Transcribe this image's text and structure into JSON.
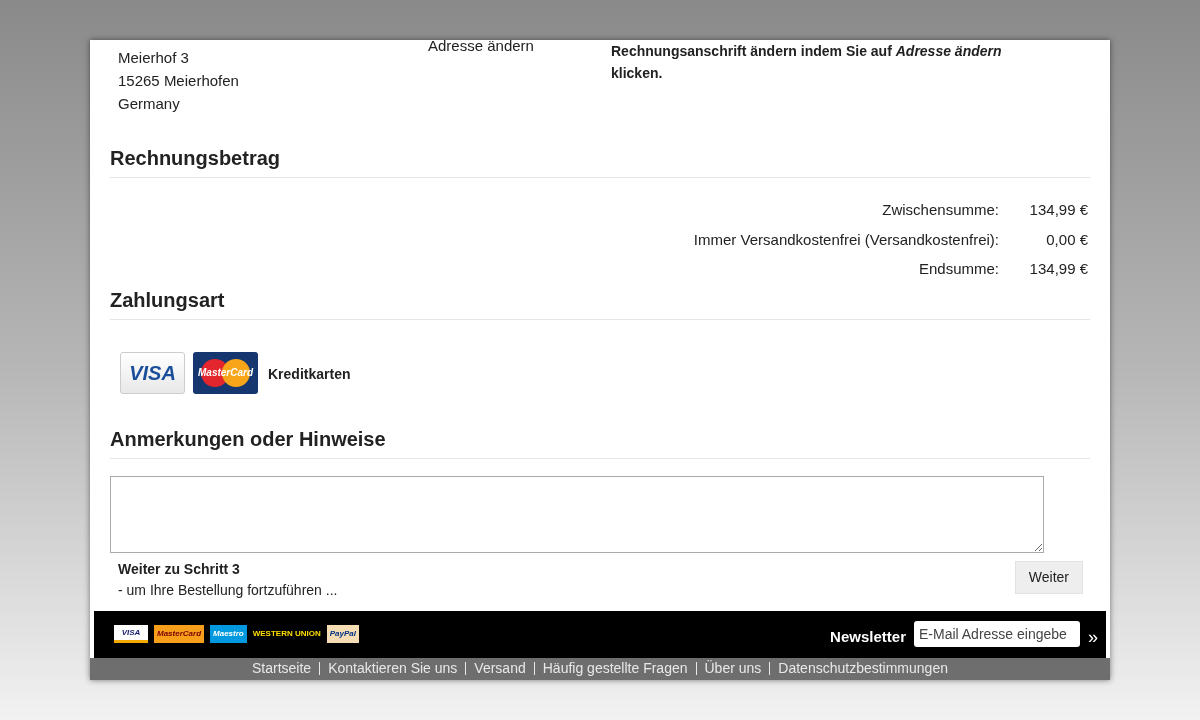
{
  "address": {
    "lines": [
      "Meierhof 3",
      "15265 Meierhofen",
      "Germany"
    ],
    "change_link": "Adresse ändern",
    "note": "Rechnungsanschrift ändern indem Sie auf *Adresse ändern* klicken."
  },
  "invoice": {
    "heading": "Rechnungsbetrag",
    "rows": [
      {
        "label": "Zwischensumme:",
        "value": "134,99 €"
      },
      {
        "label": "Immer Versandkostenfrei (Versandkostenfrei):",
        "value": "0,00 €"
      },
      {
        "label": "Endsumme:",
        "value": "134,99 €"
      }
    ]
  },
  "payment": {
    "heading": "Zahlungsart",
    "visa_logo": "VISA",
    "mastercard_logo": "MasterCard",
    "method": "Kreditkarten"
  },
  "notes": {
    "heading": "Anmerkungen oder Hinweise"
  },
  "next_step": {
    "title": "Weiter zu Schritt 3",
    "subtitle": "- um Ihre Bestellung fortzuführen ...",
    "button": "Weiter"
  },
  "footer": {
    "payment_logos": [
      {
        "kind": "visa",
        "label": "VISA"
      },
      {
        "kind": "mastercard",
        "label": "MasterCard"
      },
      {
        "kind": "maestro",
        "label": "Maestro"
      },
      {
        "kind": "westernunion",
        "label": "WESTERN UNION"
      },
      {
        "kind": "paypal",
        "label": "PayPal"
      }
    ],
    "newsletter_label": "Newsletter",
    "email_placeholder": "E-Mail Adresse eingebe",
    "submit": "»",
    "links": [
      "Startseite",
      "Kontaktieren Sie uns",
      "Versand",
      "Häufig gestellte Fragen",
      "Über uns",
      "Datenschutzbestimmungen"
    ]
  }
}
